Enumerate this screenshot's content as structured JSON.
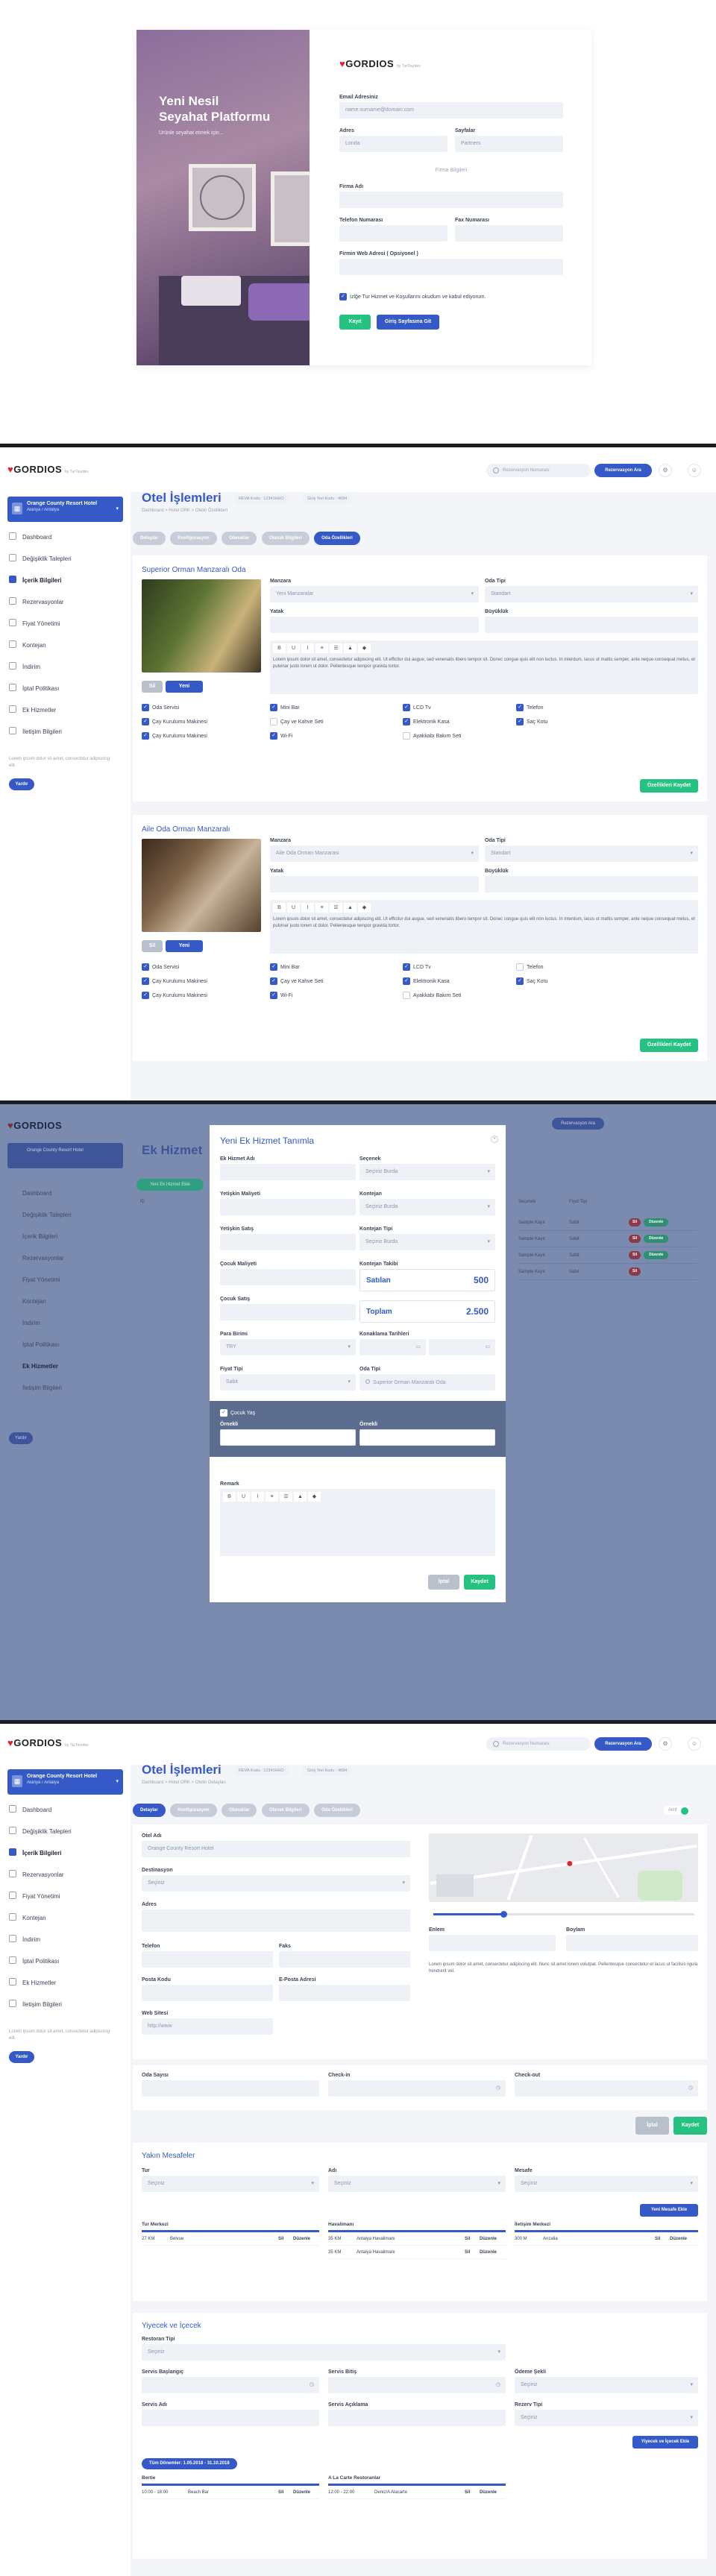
{
  "login": {
    "logo": "GORDIOS",
    "logo_sub": "by TurTourdev",
    "hero_title_1": "Yeni Nesil",
    "hero_title_2": "Seyahat Platformu",
    "hero_sub": "Ürünle seyahat etmek için...",
    "email_label": "Email Adresiniz",
    "email_value": "name.surname@domain.com",
    "adres_label": "Adres",
    "adres_value": "Londa",
    "sayfalar_label": "Sayfalar",
    "sayfalar_value": "Partners",
    "firma_bilgileri": "Firma Bilgileri",
    "firma_adi_label": "Firma Adı",
    "telefon_label": "Telefon Numarası",
    "fax_label": "Fax Numarası",
    "web_label": "Firmin Web Adresi ( Opsiyonel )",
    "terms": "İzlğe Tur Hizmet ve Koşullarını okudum ve kabul ediyorum.",
    "kayit_button": "Kayıt Ol",
    "giris_button": "Giriş Sayfasına Git"
  },
  "app": {
    "logo": "GORDIOS",
    "logo_sub": "by TurTourdev",
    "search_placeholder": "Rezervasyon Numarası",
    "reservation_button": "Rezervasyon Ara",
    "notif_icon": "⚙",
    "user_icon": "☺",
    "hotel_name": "Orange County Resort Hotel",
    "hotel_location": "Alanya / Antalya",
    "nav": [
      "Dashboard",
      "Değişiklik Talepleri",
      "İçerik Bilgileri",
      "Rezervasyonlar",
      "Fiyat Yönetimi",
      "Kontejan",
      "İndirim",
      "İptal Politikası",
      "Ek Hizmetler",
      "İletişim Bilgileri"
    ],
    "side_note": "Lorem ipsum dolor sit amet, consectetur adipiscing elit.",
    "side_button": "Yardır"
  },
  "rooms_page": {
    "title": "Otel İşlemleri",
    "tag1": "REVA Kodu : 12341HHO",
    "tag2": "Giriş Yeri Kodu : 4684",
    "crumb": "Dashboard > Hotel ORK > Otelin Özellikleri",
    "tabs": [
      "Detaylar",
      "Konfigurasyon",
      "Olanaklar",
      "Olanak Bilgileri",
      "Oda Özellikleri"
    ],
    "rooms": [
      {
        "name": "Superior Orman Manzaralı Oda",
        "manzara_value": "Yeni Manzaralar",
        "oda_tipi_value": "Standart",
        "features": [
          [
            "Oda Servisi",
            "Mini Bar",
            "LCD Tv",
            "Telefon"
          ],
          [
            "Çay Kurulumu Makinesi",
            "Çay ve Kahve Seti",
            "Elektronik Kasa",
            "Saç Kotu"
          ],
          [
            "Çay Kurulumu Makinesi",
            "Wi-Fi",
            "Ayakkabı Bakım Seti"
          ]
        ],
        "save": "Özellikleri Kaydet"
      },
      {
        "name": "Aile Oda Orman Manzaralı",
        "manzara_value": "Aile Oda Orman Manzarası",
        "oda_tipi_value": "Standart",
        "features": [
          [
            "Oda Servisi",
            "Mini Bar",
            "LCD Tv",
            "Telefon"
          ],
          [
            "Çay Kurulumu Makinesi",
            "Çay ve Kahve Seti",
            "Elektronik Kasa",
            "Saç Kotu"
          ],
          [
            "Çay Kurulumu Makinesi",
            "Wi-Fi",
            "Ayakkabı Bakım Seti"
          ]
        ],
        "save": "Özellikleri Kaydet"
      }
    ],
    "labels": {
      "manzara": "Manzara",
      "oda_tipi": "Oda Tipi",
      "yatak": "Yatak",
      "buyuklik": "Büyüklük",
      "sil": "Sil",
      "yeni_yukle": "Yeni Yükle"
    },
    "lorem": "Lorem ipsum dolor sit amet, consectetur adipiscing elit. Ut efficitur dui augue, sed venenatis libero tempor sit. Donec congue quis elit non luctus. In interdum, lacus ut mattis semper, ante neque consequat metus, et pulvinar justo lorem ut dolor. Pellentesque tempor gravida tortor."
  },
  "modal_page": {
    "bg_title": "Ek Hizmet",
    "bg_button": "Yeni Ek Hizmet Ekle",
    "title": "Yeni Ek Hizmet Tanımla",
    "ek_hizmet_adi": "Ek Hizmet Adı",
    "secenek": "Seçenek",
    "secenek_value": "Seçiniz Burda",
    "yetiskin_maliyeti": "Yetişkin Maliyeti",
    "kontejan": "Kontejan",
    "kontejan_value": "Seçiniz Burda",
    "yetiskin_sayi": "Yetişkin Satış",
    "kontejan_tipi": "Kontejan Tipi",
    "kontejan_tipi_value": "Seçiniz Burda",
    "cocuk_maliyeti": "Çocuk Maliyeti",
    "kontejan_takibi": "Kontejan Takibi",
    "satilan": "Satılan",
    "satilan_value": "500",
    "cocuk_satis": "Çocuk Satış",
    "toplam": "Toplam",
    "toplam_value": "2.500",
    "para_birimi": "Para Birimi",
    "para_birimi_value": "TRY",
    "konaklama_tarihleri": "Konaklama Tarihleri",
    "fiyat_tipi": "Fiyat Tipi",
    "fiyat_tipi_value": "Sabit",
    "oda_tipi": "Oda Tipi",
    "oda_tipi_value": "Superior Orman Manzaralı Oda",
    "cocuk_yas": "Çocuk Yaş",
    "ornek": "Örnekli",
    "ornek2": "Örnekli",
    "remark": "Remark",
    "iptal": "İptal",
    "kaydet": "Kaydet",
    "bg_table_header": [
      "ID",
      "Ek Hizmet",
      "Seçenek",
      "Fiyat Tipi"
    ],
    "bg_rows": [
      [
        "Sample Kayıt",
        "Sabit"
      ],
      [
        "Sample Kayıt",
        "Sabit"
      ],
      [
        "Sample Kayıt",
        "Sabit"
      ],
      [
        "Sample Kayıt",
        "Sabit"
      ]
    ],
    "delete_label": "Sil",
    "edit_label": "Düzenle"
  },
  "detail_page": {
    "title": "Otel İşlemleri",
    "tag1": "REVA Kodu : 12341HHO",
    "tag2": "Giriş Yeri Kodu : 4684",
    "crumb": "Dashboard > Hotel ORK > Otelin Detayları",
    "tabs": [
      "Detaylar",
      "Konfigurasyon",
      "Olanaklar",
      "Olanak Bilgileri",
      "Oda Özellikleri"
    ],
    "toggle_label": "Aktif",
    "otel_adi": "Otel Adı",
    "otel_adi_value": "Orange County Resort Hotel",
    "destinasyon": "Destinasyon",
    "destinasyon_value": "Seçiniz",
    "adres": "Adres",
    "telefon": "Telefon",
    "faks": "Faks",
    "posta_kodu": "Posta Kodu",
    "eposta": "E-Posta Adresi",
    "web_sitesi": "Web Sitesi",
    "web_value": "http://www",
    "enlem": "Enlem",
    "boylam": "Boylam",
    "lorem": "Lorem ipsum dolor sit amet, consectetur adipiscing elit. Nunc sit amet lorem volutpat. Pellentesque consectetur et lacus ut facilisis ligula hendrerit vel.",
    "oda_sayisi": "Oda Sayısı",
    "check_in": "Check-in",
    "check_out": "Check-out",
    "iptal": "İptal",
    "kaydet": "Kaydet",
    "mesafeler_title": "Yakın Mesafeler",
    "tur": "Tur",
    "adi": "Adı",
    "mesafe": "Mesafe",
    "seciniz": "Seçiniz",
    "yeni_mesafe": "Yeni Mesafe Ekle",
    "cols": [
      {
        "head": "Tur Merkezi",
        "rows": [
          [
            "27 KM",
            "Belvue",
            "Sil",
            "Düzenle"
          ]
        ]
      },
      {
        "head": "Havalimanı",
        "rows": [
          [
            "35 KM",
            "Antalya Havalimanı",
            "Sil",
            "Düzenle"
          ],
          [
            "35 KM",
            "Antalya Havalimanı",
            "Sil",
            "Düzenle"
          ]
        ]
      },
      {
        "head": "İletişim Merkezi",
        "rows": [
          [
            "300 M",
            "Anzalia",
            "Sil",
            "Düzenle"
          ]
        ]
      }
    ],
    "yiyecek_title": "Yiyecek ve İçecek",
    "restoran_tipi": "Restoran Tipi",
    "servis_baslangic": "Servis Başlangıç",
    "servis_bitis": "Servis Bitiş",
    "odeme_secenegi": "Ödeme Şekli",
    "servis_adi": "Servis Adı",
    "servis_aciklama": "Servis Açıklama",
    "rezerve_tipi": "Rezerv Tipi",
    "yeni_yiyecek": "Yiyecek ve İçecek Ekle",
    "date_chip": "Tüm Dönemler: 1.05.2018 - 31.10.2018",
    "food_cols": [
      {
        "head": "Bertie",
        "rows": [
          [
            "10:00 - 18:00",
            "Beach Bar",
            "Sil",
            "Düzenle"
          ]
        ]
      },
      {
        "head": "A La Carte Restoranlar",
        "rows": [
          [
            "12:00 - 22:00",
            "Deniz/A Alacarte",
            "Sil",
            "Düzenle"
          ]
        ]
      }
    ]
  }
}
